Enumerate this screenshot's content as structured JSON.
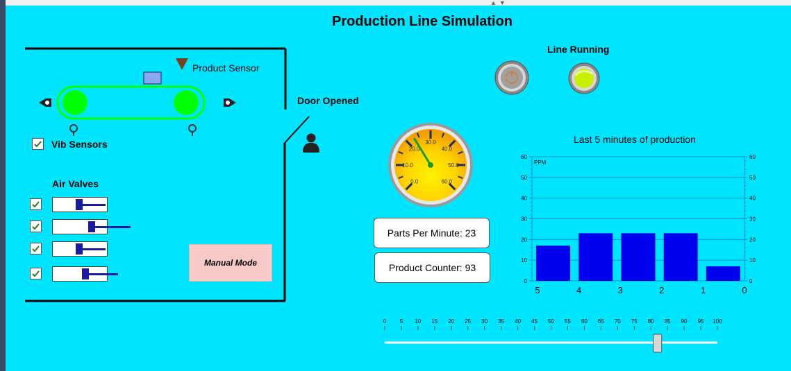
{
  "window": {
    "title": "Production Line Simulation"
  },
  "conveyor": {
    "product_sensor_label": "Product Sensor",
    "vib_sensors_label": "Vib Sensors",
    "vib_sensors_checked": true
  },
  "air_valves": {
    "label": "Air Valves",
    "valves": [
      {
        "checked": true,
        "level": 0.25
      },
      {
        "checked": true,
        "level": 0.55
      },
      {
        "checked": true,
        "level": 0.25
      },
      {
        "checked": true,
        "level": 0.4
      }
    ]
  },
  "door": {
    "label": "Door Opened"
  },
  "manual_mode": {
    "label": "Manual Mode"
  },
  "line_status": {
    "label": "Line Running",
    "indicator_color": "#c8f000"
  },
  "gauge": {
    "ticks": [
      "0.0",
      "10.0",
      "20.0",
      "30.0",
      "40.0",
      "50.0",
      "60.0"
    ],
    "min": 0,
    "max": 60,
    "value": 23
  },
  "stats": {
    "ppm_label": "Parts Per Minute: 23",
    "counter_label": "Product Counter: 93"
  },
  "chart_data": {
    "type": "bar",
    "title": "Last 5 minutes of production",
    "ylabel": "PPM",
    "ylim": [
      0,
      60
    ],
    "yticks": [
      "0",
      "10",
      "20",
      "30",
      "40",
      "50",
      "60"
    ],
    "xticks": [
      "5",
      "4",
      "3",
      "2",
      "1",
      "0"
    ],
    "values": [
      17,
      23,
      23,
      23,
      7
    ],
    "bar_color": "#0000ee",
    "grid": true
  },
  "speed_slider": {
    "ticks": [
      "0",
      "5",
      "10",
      "15",
      "20",
      "25",
      "30",
      "35",
      "40",
      "45",
      "50",
      "55",
      "60",
      "65",
      "70",
      "75",
      "80",
      "85",
      "90",
      "95",
      "100"
    ],
    "min": 0,
    "max": 100,
    "value": 82
  },
  "colors": {
    "background": "#00e5ff",
    "conveyor_roller": "#00ff00",
    "product_box": "#8aa8f0",
    "sensor_triangle": "#7a4020"
  }
}
